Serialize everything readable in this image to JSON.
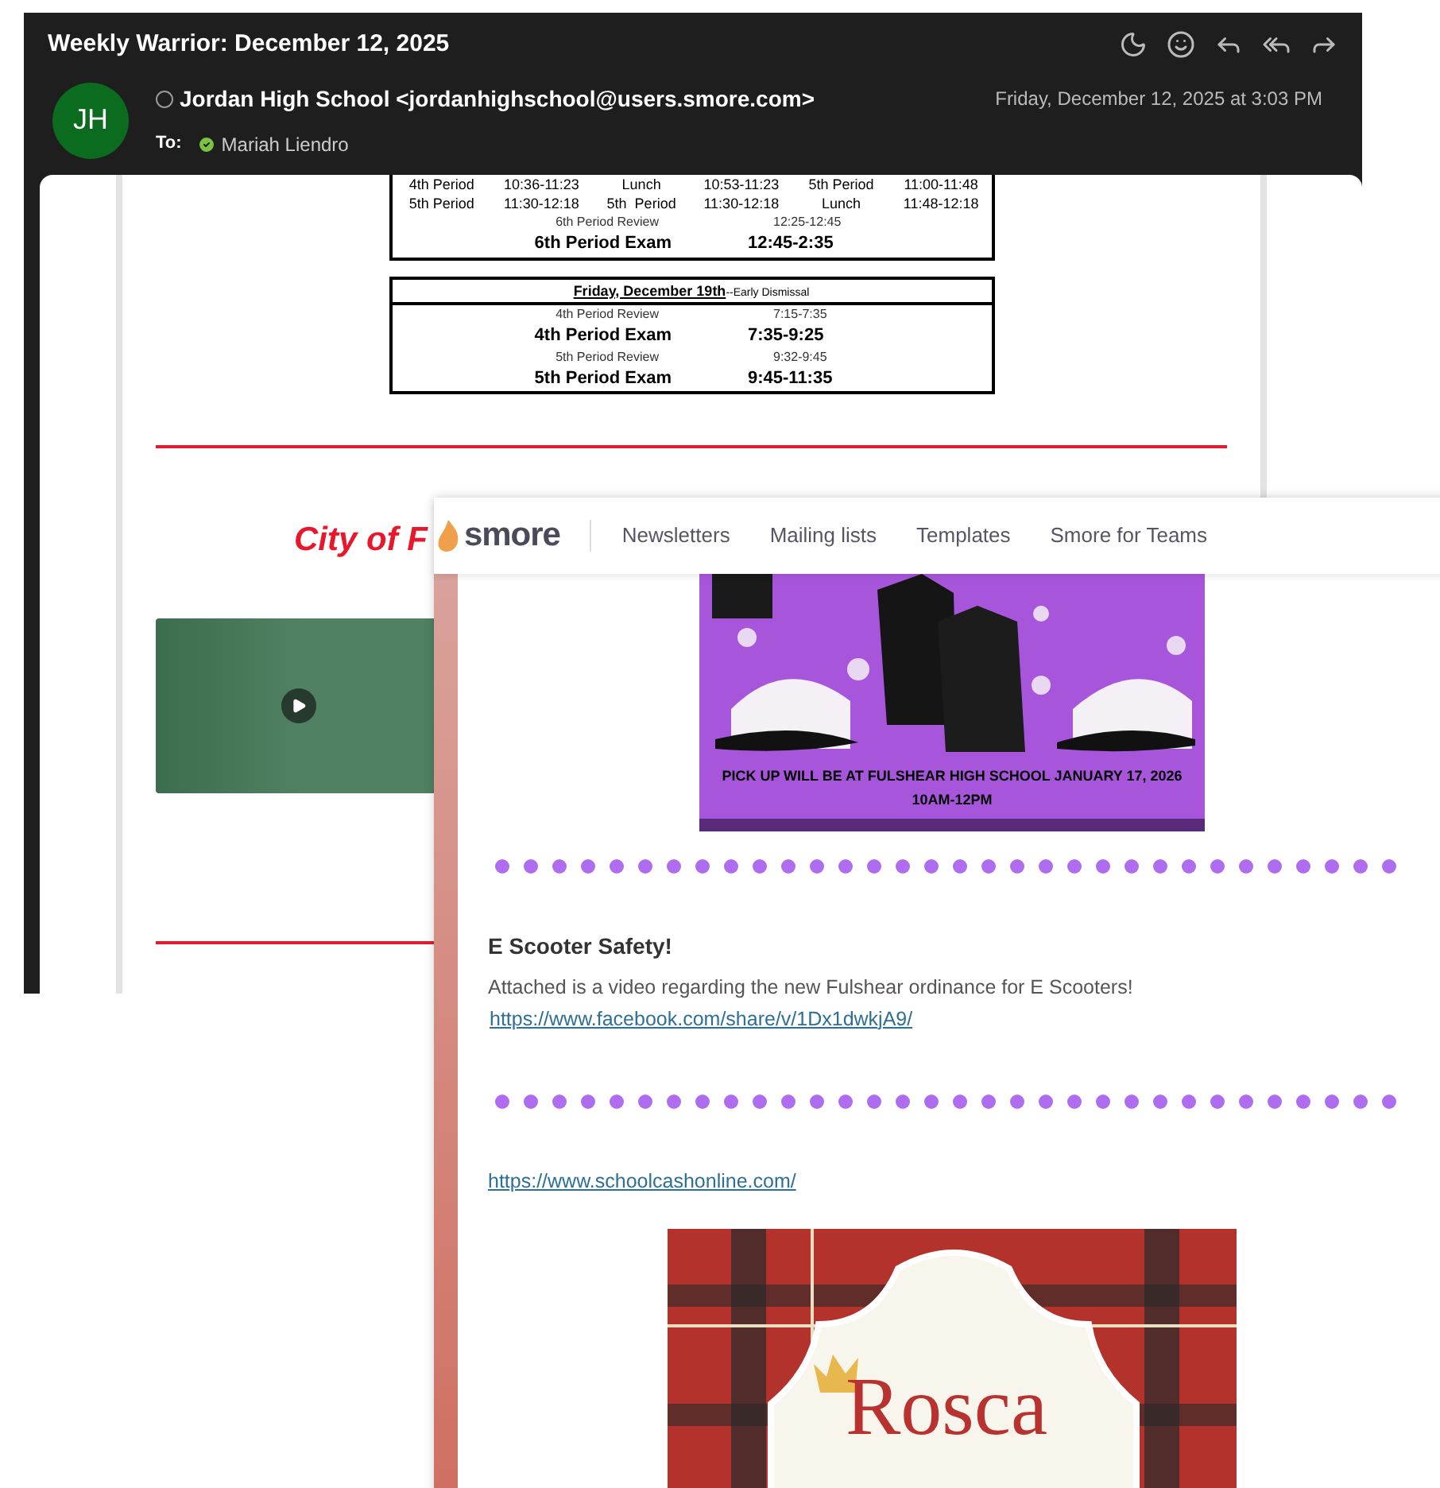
{
  "email": {
    "subject": "Weekly Warrior: December 12, 2025",
    "avatar_initials": "JH",
    "sender": "Jordan High School <jordanhighschool@users.smore.com>",
    "to_label": "To:",
    "recipient": "Mariah Liendro",
    "date": "Friday, December 12, 2025 at 3:03 PM",
    "schedule_tables": [
      {
        "rows": [
          {
            "kind": "grid",
            "cells": [
              "4th Period",
              "10:36-11:23",
              "Lunch",
              "10:53-11:23",
              "5th Period",
              "11:00-11:48"
            ]
          },
          {
            "kind": "grid",
            "cells": [
              "5th Period",
              "11:30-12:18",
              "5th  Period",
              "11:30-12:18",
              "Lunch",
              "11:48-12:18"
            ]
          },
          {
            "kind": "review",
            "cells": [
              "6th Period Review",
              "12:25-12:45"
            ]
          },
          {
            "kind": "exam",
            "cells": [
              "6th Period Exam",
              "12:45-2:35"
            ]
          }
        ]
      },
      {
        "title": "Friday, December 19th",
        "note": "--Early Dismissal",
        "rows": [
          {
            "kind": "review",
            "cells": [
              "4th Period Review",
              "7:15-7:35"
            ]
          },
          {
            "kind": "exam",
            "cells": [
              "4th Period Exam",
              "7:35-9:25"
            ]
          },
          {
            "kind": "review",
            "cells": [
              "5th Period Review",
              "9:32-9:45"
            ]
          },
          {
            "kind": "exam",
            "cells": [
              "5th Period Exam",
              "9:45-11:35"
            ]
          }
        ]
      }
    ],
    "city_logo": "City of F"
  },
  "smore": {
    "brand": "smore",
    "nav": [
      "Newsletters",
      "Mailing lists",
      "Templates",
      "Smore for Teams"
    ],
    "flyer_caption": [
      "PICK UP WILL BE AT FULSHEAR HIGH SCHOOL JANUARY 17, 2026",
      "10AM-12PM"
    ],
    "section_title": "E Scooter Safety!",
    "section_body": "Attached is a video regarding the new Fulshear ordinance for E Scooters!",
    "links": [
      "https://www.facebook.com/share/v/1Dx1dwkjA9/",
      "https://www.schoolcashonline.com/"
    ],
    "rosca_title": "Rosca"
  }
}
